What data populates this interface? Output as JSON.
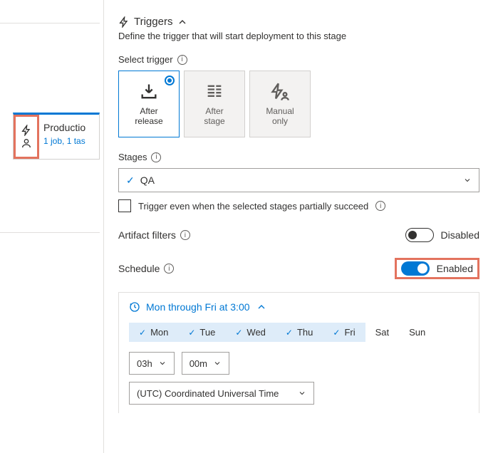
{
  "stage": {
    "name": "Productio",
    "subtitle": "1 job, 1 tas"
  },
  "triggers": {
    "heading": "Triggers",
    "subtitle": "Define the trigger that will start deployment to this stage",
    "select_label": "Select trigger",
    "options": {
      "after_release": {
        "line1": "After",
        "line2": "release"
      },
      "after_stage": {
        "line1": "After",
        "line2": "stage"
      },
      "manual": {
        "line1": "Manual",
        "line2": "only"
      }
    },
    "stages_label": "Stages",
    "selected_stage": "QA",
    "partial_label": "Trigger even when the selected stages partially succeed"
  },
  "artifact": {
    "label": "Artifact filters",
    "state": "Disabled"
  },
  "schedule": {
    "label": "Schedule",
    "state": "Enabled",
    "summary": "Mon through Fri at 3:00",
    "days": {
      "mon": "Mon",
      "tue": "Tue",
      "wed": "Wed",
      "thu": "Thu",
      "fri": "Fri",
      "sat": "Sat",
      "sun": "Sun"
    },
    "hour": "03h",
    "minute": "00m",
    "timezone": "(UTC) Coordinated Universal Time"
  }
}
